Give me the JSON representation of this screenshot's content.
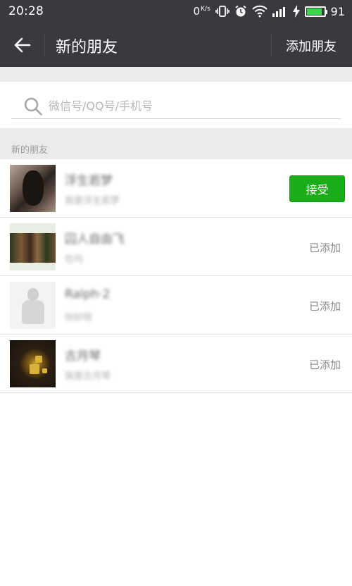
{
  "status_bar": {
    "time": "20:28",
    "net_speed_value": "0",
    "net_speed_unit": "K/s",
    "battery_level": "91",
    "icons": [
      "vibrate-icon",
      "alarm-icon",
      "wifi-icon",
      "signal-icon",
      "charging-icon",
      "battery-icon"
    ]
  },
  "app_bar": {
    "title": "新的朋友",
    "add_friend_label": "添加朋友",
    "back_icon": "arrow-left-icon"
  },
  "search": {
    "placeholder": "微信号/QQ号/手机号",
    "value": ""
  },
  "section": {
    "title": "新的朋友"
  },
  "friends": [
    {
      "name": "浮生若梦",
      "message": "我是浮生若梦",
      "action": "接受",
      "action_type": "button"
    },
    {
      "name": "囚人自由飞",
      "message": "在吗",
      "action": "已添加",
      "action_type": "status"
    },
    {
      "name": "Ralph·2",
      "message": "你好呀",
      "action": "已添加",
      "action_type": "status"
    },
    {
      "name": "古月琴",
      "message": "我是古月琴",
      "action": "已添加",
      "action_type": "status"
    }
  ],
  "colors": {
    "header_bg": "#393a3f",
    "accent_green": "#1aad19",
    "page_bg": "#ebebeb"
  }
}
